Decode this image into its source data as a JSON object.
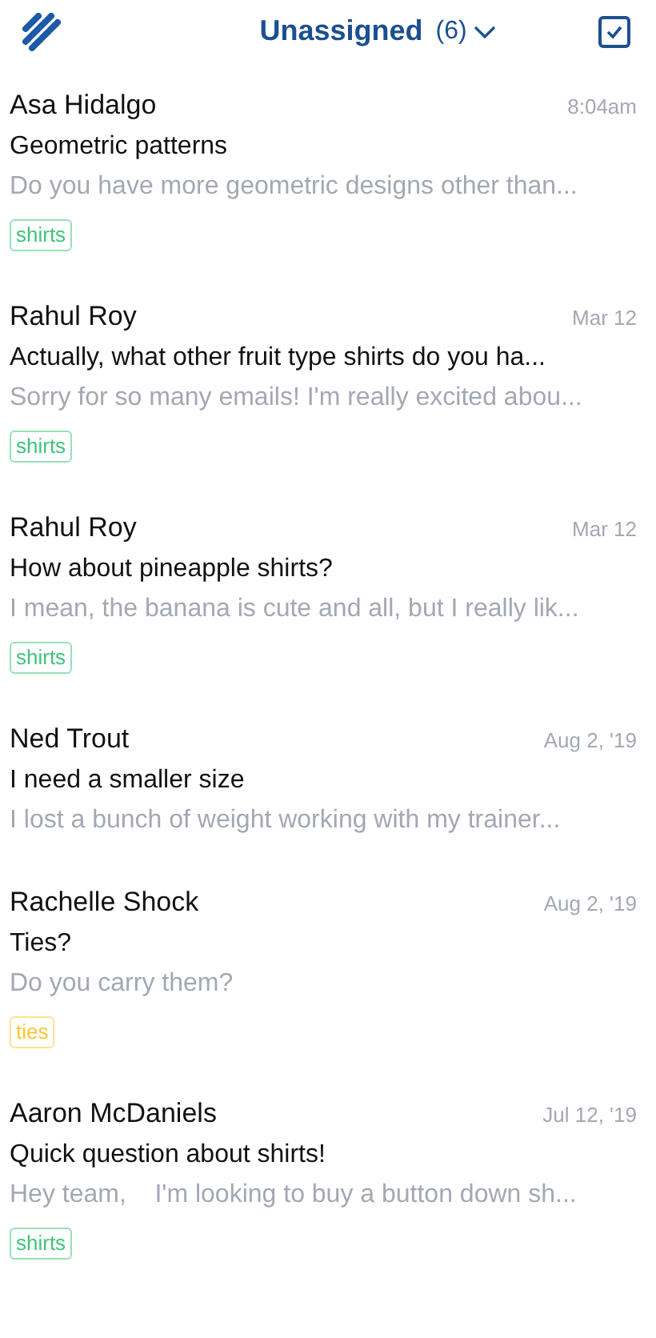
{
  "header": {
    "title": "Unassigned",
    "count": "(6)"
  },
  "conversations": [
    {
      "name": "Asa Hidalgo",
      "time": "8:04am",
      "subject": "Geometric patterns",
      "preview": "Do you have more geometric designs other than...",
      "tags": [
        {
          "label": "shirts",
          "color": "#3ec47a"
        }
      ]
    },
    {
      "name": "Rahul Roy",
      "time": "Mar 12",
      "subject": "Actually, what other fruit type shirts do you ha...",
      "preview": "Sorry for so many emails! I'm really excited abou...",
      "tags": [
        {
          "label": "shirts",
          "color": "#3ec47a"
        }
      ]
    },
    {
      "name": "Rahul Roy",
      "time": "Mar 12",
      "subject": "How about pineapple shirts?",
      "preview": "I mean, the banana is cute and all, but I really lik...",
      "tags": [
        {
          "label": "shirts",
          "color": "#3ec47a"
        }
      ]
    },
    {
      "name": "Ned Trout",
      "time": "Aug 2, '19",
      "subject": "I need a smaller size",
      "preview": "I lost a bunch of weight working with my trainer..."
    },
    {
      "name": "Rachelle Shock",
      "time": "Aug 2, '19",
      "subject": "Ties?",
      "preview": "Do you carry them?",
      "tags": [
        {
          "label": "ties",
          "color": "#f5c832"
        }
      ]
    },
    {
      "name": "Aaron McDaniels",
      "time": "Jul 12, '19",
      "subject": "Quick question about shirts!",
      "preview": "Hey team,    I'm looking to buy a button down sh...",
      "tags": [
        {
          "label": "shirts",
          "color": "#3ec47a"
        }
      ]
    }
  ]
}
